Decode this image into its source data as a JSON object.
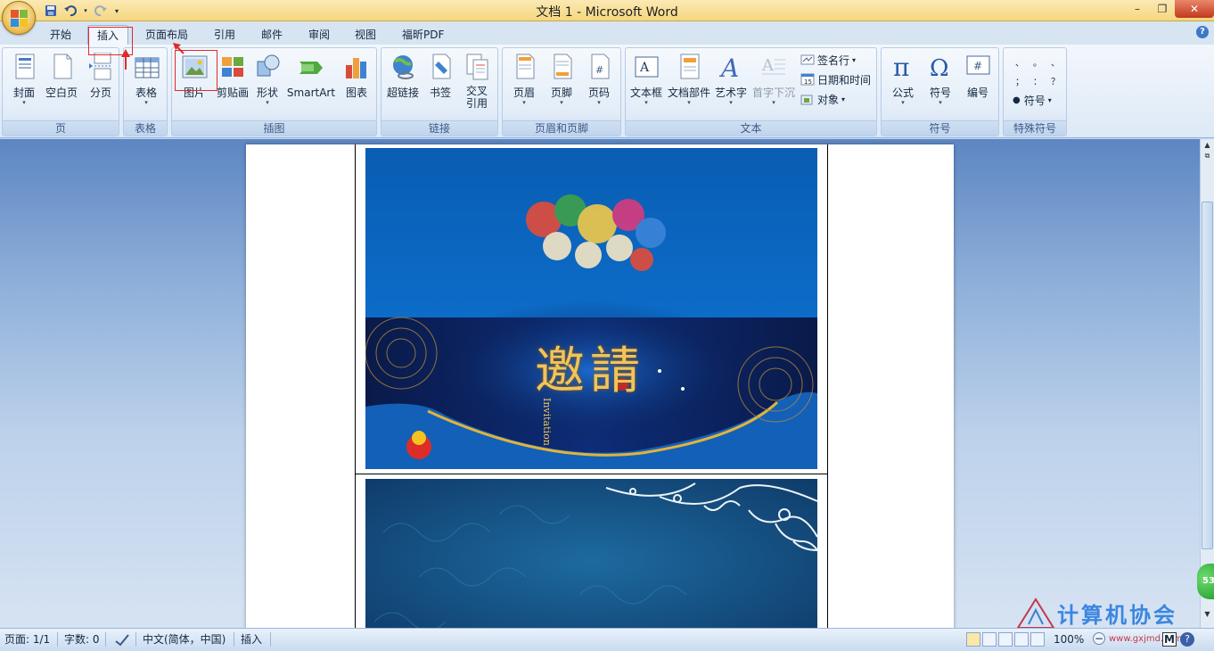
{
  "window": {
    "title": "文档 1 - Microsoft Word",
    "minimize": "–",
    "maximize": "❐",
    "close": "✕"
  },
  "quick_access": [
    "save-icon",
    "undo-icon",
    "redo-icon",
    "customize-icon"
  ],
  "tabs": [
    {
      "label": "开始"
    },
    {
      "label": "插入",
      "active": true
    },
    {
      "label": "页面布局"
    },
    {
      "label": "引用"
    },
    {
      "label": "邮件"
    },
    {
      "label": "审阅"
    },
    {
      "label": "视图"
    },
    {
      "label": "福昕PDF"
    }
  ],
  "help_label": "?",
  "ribbon": {
    "pages": {
      "label": "页",
      "buttons": [
        "封面",
        "空白页",
        "分页"
      ]
    },
    "tables": {
      "label": "表格",
      "buttons": [
        "表格"
      ]
    },
    "illustrations": {
      "label": "插图",
      "buttons": [
        "图片",
        "剪贴画",
        "形状",
        "SmartArt",
        "图表"
      ]
    },
    "links": {
      "label": "链接",
      "buttons": [
        "超链接",
        "书签",
        "交叉\n引用"
      ]
    },
    "header_footer": {
      "label": "页眉和页脚",
      "buttons": [
        "页眉",
        "页脚",
        "页码"
      ]
    },
    "text": {
      "label": "文本",
      "buttons": [
        "文本框",
        "文档部件",
        "艺术字",
        "首字下沉"
      ],
      "small": [
        "签名行",
        "日期和时间",
        "对象"
      ]
    },
    "symbols": {
      "label": "符号",
      "buttons": [
        "公式",
        "符号",
        "编号"
      ]
    },
    "special": {
      "label": "特殊符号",
      "glyphs": [
        "、",
        "。",
        "、",
        "；",
        "：",
        "？"
      ],
      "more": "符号"
    }
  },
  "document": {
    "image1_calligraphy": "邀請",
    "image1_subtitle": "Invitation"
  },
  "status": {
    "page": "页面: 1/1",
    "words": "字数: 0",
    "language": "中文(简体，中国)",
    "mode": "插入",
    "zoom": "100%"
  },
  "watermark_text": "计算机协会",
  "watermark_url": "www.gxjmd.com",
  "badge": "53",
  "colors": {
    "title_bar": "#f5d77f",
    "ribbon": "#dde9f6",
    "accent_red": "#e02a2a",
    "doc_bg": "#8fb0d9"
  }
}
